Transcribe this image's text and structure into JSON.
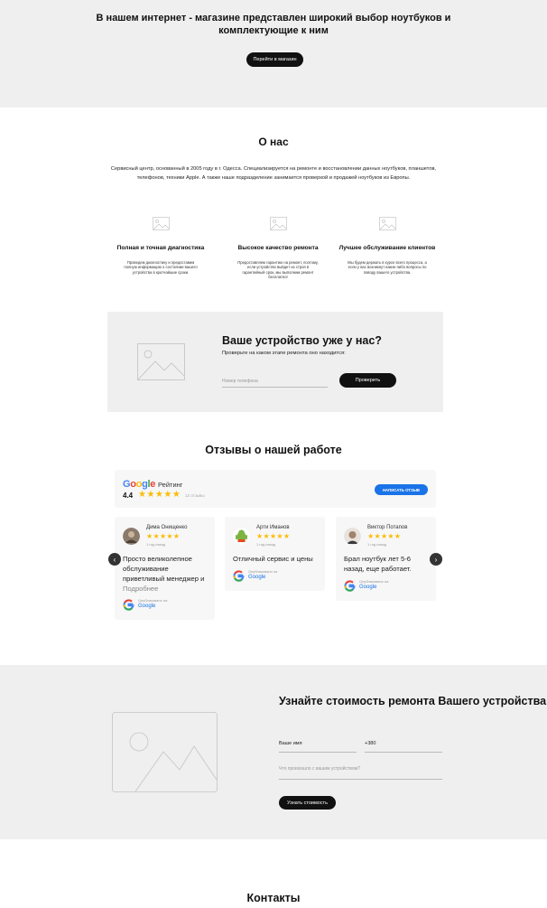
{
  "hero": {
    "title": "В нашем интернет - магазине представлен широкий выбор ноутбуков и комплектующие к ним",
    "button_label": "Перейти в магазин"
  },
  "about": {
    "title": "О нас",
    "text": "Сервисный центр, основанный в 2005 году в г. Одесса. Специализируется на ремонте и восстановлении данных ноутбуков, планшетов, телефонов, техники Apple. А также наше подразделение занимается проверкой и продажей ноутбуков из Европы.",
    "features": [
      {
        "title": "Полная и точная диагностика",
        "text": "Проведем диагностику и предоставим полную информацию о состоянии вашего устройства в кратчайшие сроки."
      },
      {
        "title": "Высокое качество ремонта",
        "text": "Предоставляем гарантию на ремонт, поэтому, если устройство выйдет из строя в гарантийный срок, мы выполним ремонт бесплатно!"
      },
      {
        "title": "Лучшее обслуживание клиентов",
        "text": "Мы будем держать в курсе всего процесса, а если у вас возникнут какие-либо вопросы по поводу вашего устройства."
      }
    ]
  },
  "status": {
    "title": "Ваше устройство уже у нас?",
    "subtitle": "Проверьте на каком этапе ремонта оно находится:",
    "phone_placeholder": "Номер телефона",
    "button_label": "Проверить"
  },
  "reviews": {
    "title": "Отзывы о нашей работе",
    "google_label": "Google",
    "rating_label": "Рейтинг",
    "score": "4.4",
    "stars": "★★★★★",
    "count": "12 отзывы",
    "write_button": "НАПИСАТЬ ОТЗЫВ",
    "published_on": "Опубликовано на",
    "items": [
      {
        "name": "Дима Онищенко",
        "stars": "★★★★★",
        "time": "1 год назад",
        "text": "Просто великолепное обслуживание приветливый менеджер и",
        "more": "Подробнее"
      },
      {
        "name": "Арти Иманов",
        "stars": "★★★★★",
        "time": "1 год назад",
        "text": "Отличный сервис и цены"
      },
      {
        "name": "Виктор Потапов",
        "stars": "★★★★★",
        "time": "1 год назад",
        "text": "Брал ноутбук лет 5-6 назад, еще работает."
      }
    ],
    "prev_icon": "chevron-left-icon",
    "next_icon": "chevron-right-icon"
  },
  "calc": {
    "title": "Узнайте стоимость ремонта Вашего устройства",
    "name_field": "Ваше имя",
    "phone_field": "+380",
    "problem_placeholder": "Что произошло с вашим устройством?",
    "button_label": "Узнать стоимость"
  },
  "contacts": {
    "title": "Контакты"
  },
  "colors": {
    "section_bg": "#efefef",
    "button_black": "#111111",
    "google_blue": "#1a73e8",
    "star_yellow": "#fbbc04"
  }
}
